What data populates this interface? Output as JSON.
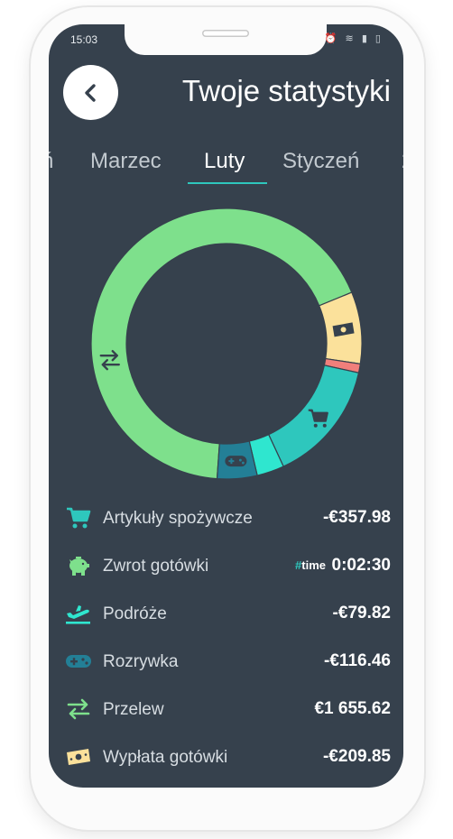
{
  "status_bar": {
    "time": "15:03",
    "icons": "⏰ ≋ ▮ ▯"
  },
  "header": {
    "title": "Twoje statystyki",
    "back_icon": "chevron-left-icon"
  },
  "tabs": [
    {
      "label": "ń"
    },
    {
      "label": "Marzec"
    },
    {
      "label": "Luty",
      "active": true
    },
    {
      "label": "Styczeń"
    },
    {
      "label": "2"
    }
  ],
  "chart_data": {
    "type": "pie",
    "variant": "donut",
    "slices": [
      {
        "category": "Przelew",
        "value": 1655.62,
        "color": "#7ee08c",
        "icon": "transfer-icon"
      },
      {
        "category": "Wypłata gotówki",
        "value": 209.85,
        "color": "#fbe19b",
        "icon": "cash-icon"
      },
      {
        "category": "Zwrot gotówki",
        "value": 26.0,
        "color": "#f07f7b"
      },
      {
        "category": "Artykuły spożywcze",
        "value": 357.98,
        "color": "#2ec7bd",
        "icon": "cart-icon"
      },
      {
        "category": "Podróże",
        "value": 79.82,
        "color": "#2fe6cf"
      },
      {
        "category": "Rozrywka",
        "value": 116.46,
        "color": "#237f96",
        "icon": "gamepad-icon"
      }
    ]
  },
  "categories": [
    {
      "label": "Artykuły spożywcze",
      "amount": "-€357.98",
      "icon": "cart-icon",
      "color": "#2ec7bd"
    },
    {
      "label": "Zwrot gotówki",
      "amount": "0:02:30",
      "badge": "#time",
      "icon": "piggy-bank-icon",
      "color": "#7ee08c"
    },
    {
      "label": "Podróże",
      "amount": "-€79.82",
      "icon": "airplane-icon",
      "color": "#2fe6cf"
    },
    {
      "label": "Rozrywka",
      "amount": "-€116.46",
      "icon": "gamepad-icon",
      "color": "#237f96"
    },
    {
      "label": "Przelew",
      "amount": "€1 655.62",
      "icon": "transfer-icon",
      "color": "#7ee08c"
    },
    {
      "label": "Wypłata gotówki",
      "amount": "-€209.85",
      "icon": "cash-icon",
      "color": "#fbe19b"
    }
  ],
  "badge": {
    "hash": "#",
    "word": "time"
  }
}
